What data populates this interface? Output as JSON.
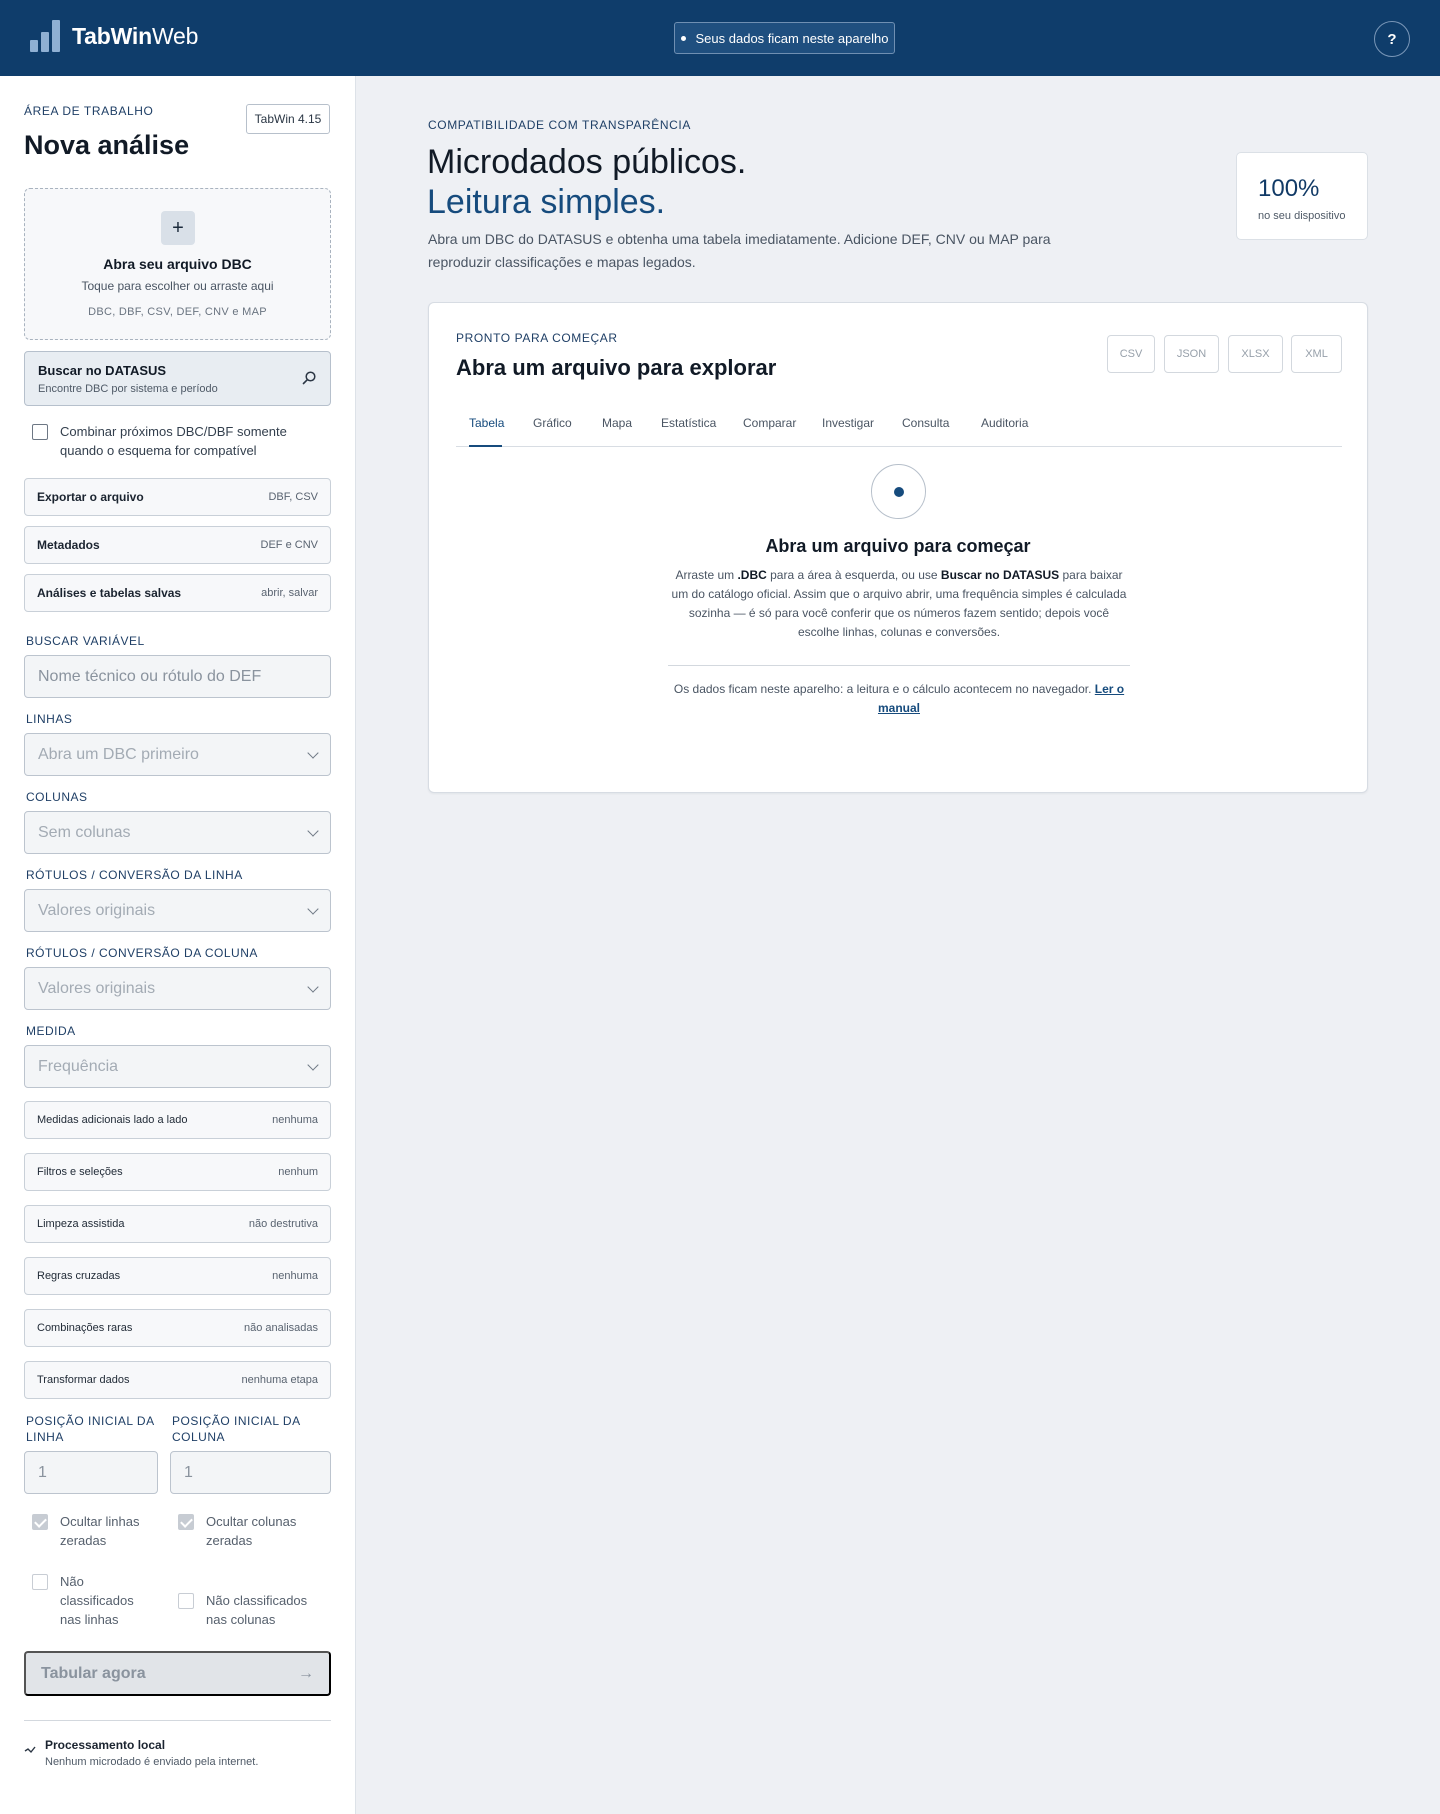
{
  "header": {
    "brand_bold": "TabWin",
    "brand_light": "Web",
    "privacy_pill": "Seus dados ficam neste aparelho",
    "help_label": "?"
  },
  "sidebar": {
    "eyebrow": "ÁREA DE TRABALHO",
    "title": "Nova análise",
    "version": "TabWin 4.15",
    "dropzone": {
      "plus": "+",
      "title": "Abra seu arquivo DBC",
      "subtitle": "Toque para escolher ou arraste aqui",
      "types": "DBC, DBF, CSV, DEF, CNV e MAP"
    },
    "datasus": {
      "title": "Buscar no DATASUS",
      "subtitle": "Encontre DBC por sistema e período"
    },
    "combine_label": "Combinar próximos DBC/DBF somente quando o esquema for compatível",
    "actions": [
      {
        "label": "Exportar o arquivo",
        "meta": "DBF, CSV"
      },
      {
        "label": "Metadados",
        "meta": "DEF e CNV"
      },
      {
        "label": "Análises e tabelas salvas",
        "meta": "abrir, salvar"
      }
    ],
    "search_variable": {
      "label": "BUSCAR VARIÁVEL",
      "placeholder": "Nome técnico ou rótulo do DEF"
    },
    "rows": {
      "label": "LINHAS",
      "value": "Abra um DBC primeiro"
    },
    "columns": {
      "label": "COLUNAS",
      "value": "Sem colunas"
    },
    "row_labels": {
      "label": "RÓTULOS / CONVERSÃO DA LINHA",
      "value": "Valores originais"
    },
    "col_labels": {
      "label": "RÓTULOS / CONVERSÃO DA COLUNA",
      "value": "Valores originais"
    },
    "measure": {
      "label": "MEDIDA",
      "value": "Frequência"
    },
    "options": [
      {
        "label": "Medidas adicionais lado a lado",
        "meta": "nenhuma"
      },
      {
        "label": "Filtros e seleções",
        "meta": "nenhum"
      },
      {
        "label": "Limpeza assistida",
        "meta": "não destrutiva"
      },
      {
        "label": "Regras cruzadas",
        "meta": "nenhuma"
      },
      {
        "label": "Combinações raras",
        "meta": "não analisadas"
      },
      {
        "label": "Transformar dados",
        "meta": "nenhuma etapa"
      }
    ],
    "start_row": {
      "label": "POSIÇÃO INICIAL DA LINHA",
      "value": "1"
    },
    "start_col": {
      "label": "POSIÇÃO INICIAL DA COLUNA",
      "value": "1"
    },
    "hide_zero_rows": "Ocultar linhas zeradas",
    "hide_zero_cols": "Ocultar colunas zeradas",
    "unclassified_rows": "Não classificados nas linhas",
    "unclassified_cols": "Não classificados nas colunas",
    "tabulate": {
      "label": "Tabular agora",
      "arrow": "→"
    },
    "local": {
      "title": "Processamento local",
      "subtitle": "Nenhum microdado é enviado pela internet."
    }
  },
  "main": {
    "eyebrow": "COMPATIBILIDADE COM TRANSPARÊNCIA",
    "title_line1": "Microdados públicos.",
    "title_line2": "Leitura simples.",
    "description": "Abra um DBC do DATASUS e obtenha uma tabela imediatamente. Adicione DEF, CNV ou MAP para reproduzir classificações e mapas legados.",
    "stat": {
      "value": "100%",
      "label": "no seu dispositivo"
    },
    "panel": {
      "eyebrow": "PRONTO PARA COMEÇAR",
      "title": "Abra um arquivo para explorar",
      "exports": [
        "CSV",
        "JSON",
        "XLSX",
        "XML"
      ],
      "tabs": [
        "Tabela",
        "Gráfico",
        "Mapa",
        "Estatística",
        "Comparar",
        "Investigar",
        "Consulta",
        "Auditoria"
      ],
      "empty": {
        "title": "Abra um arquivo para começar",
        "desc_a": "Arraste um ",
        "desc_b": ".DBC",
        "desc_c": " para a área à esquerda, ou use ",
        "desc_d": "Buscar no DATASUS",
        "desc_e": " para baixar um do catálogo oficial. Assim que o arquivo abrir, uma frequência simples é calculada sozinha — é só para você conferir que os números fazem sentido; depois você escolhe linhas, colunas e conversões.",
        "foot": "Os dados ficam neste aparelho: a leitura e o cálculo acontecem no navegador. ",
        "foot_link": "Ler o manual"
      }
    }
  }
}
